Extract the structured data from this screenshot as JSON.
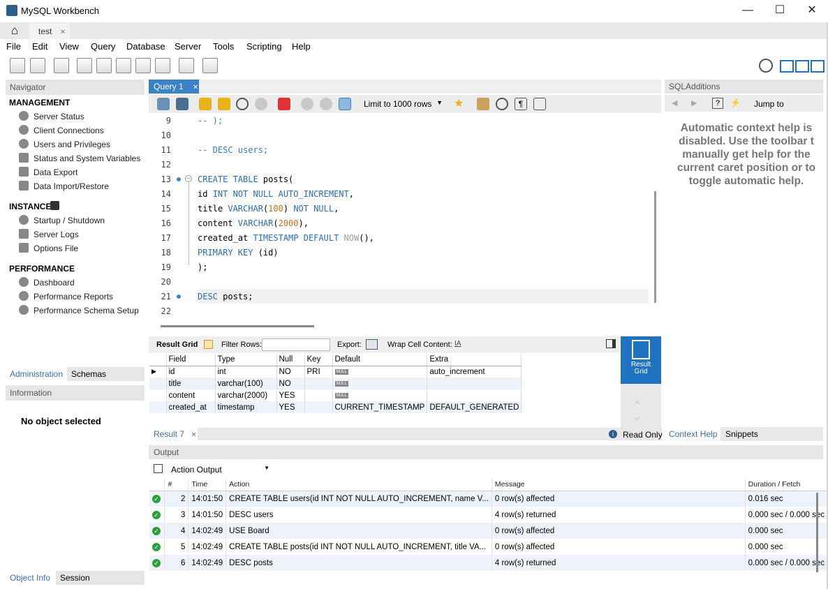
{
  "window": {
    "title": "MySQL Workbench",
    "minimize": "—",
    "maximize": "☐",
    "close": "✕"
  },
  "tabs": {
    "home_icon": "home-icon",
    "connection_tab": "test",
    "connection_close": "✕"
  },
  "menu": [
    "File",
    "Edit",
    "View",
    "Query",
    "Database",
    "Server",
    "Tools",
    "Scripting",
    "Help"
  ],
  "navigator": {
    "header": "Navigator",
    "management": {
      "title": "MANAGEMENT",
      "items": [
        "Server Status",
        "Client Connections",
        "Users and Privileges",
        "Status and System Variables",
        "Data Export",
        "Data Import/Restore"
      ]
    },
    "instance": {
      "title": "INSTANCE",
      "items": [
        "Startup / Shutdown",
        "Server Logs",
        "Options File"
      ]
    },
    "performance": {
      "title": "PERFORMANCE",
      "items": [
        "Dashboard",
        "Performance Reports",
        "Performance Schema Setup"
      ]
    },
    "tabs": [
      "Administration",
      "Schemas"
    ]
  },
  "information": {
    "header": "Information",
    "message": "No object selected",
    "tabs": [
      "Object Info",
      "Session"
    ]
  },
  "query_tab": {
    "label": "Query 1",
    "close": "✕",
    "limit": "Limit to 1000 rows"
  },
  "editor": {
    "lines": [
      "9",
      "10",
      "11",
      "12",
      "13",
      "14",
      "15",
      "16",
      "17",
      "18",
      "19",
      "20",
      "21",
      "22"
    ]
  },
  "result": {
    "result_grid_label": "Result Grid",
    "filter_label": "Filter Rows:",
    "export_label": "Export:",
    "wrap_label": "Wrap Cell Content:",
    "columns": [
      "Field",
      "Type",
      "Null",
      "Key",
      "Default",
      "Extra"
    ],
    "rows": [
      [
        "id",
        "int",
        "NO",
        "PRI",
        "NULL",
        "auto_increment"
      ],
      [
        "title",
        "varchar(100)",
        "NO",
        "",
        "NULL",
        ""
      ],
      [
        "content",
        "varchar(2000)",
        "YES",
        "",
        "NULL",
        ""
      ],
      [
        "created_at",
        "timestamp",
        "YES",
        "",
        "CURRENT_TIMESTAMP",
        "DEFAULT_GENERATED"
      ]
    ],
    "side_button": "Result Grid",
    "tab": "Result 7",
    "read_only": "Read Only"
  },
  "output": {
    "header": "Output",
    "selector": "Action Output",
    "columns": [
      "#",
      "Time",
      "Action",
      "Message",
      "Duration / Fetch"
    ],
    "rows": [
      [
        "2",
        "14:01:50",
        "CREATE TABLE users(id INT NOT NULL AUTO_INCREMENT, name V...",
        "0 row(s) affected",
        "0.016 sec"
      ],
      [
        "3",
        "14:01:50",
        "DESC users",
        "4 row(s) returned",
        "0.000 sec / 0.000 sec"
      ],
      [
        "4",
        "14:02:49",
        "USE Board",
        "0 row(s) affected",
        "0.000 sec"
      ],
      [
        "5",
        "14:02:49",
        "CREATE TABLE posts(id INT NOT NULL AUTO_INCREMENT, title VA...",
        "0 row(s) affected",
        "0.000 sec"
      ],
      [
        "6",
        "14:02:49",
        "DESC posts",
        "4 row(s) returned",
        "0.000 sec / 0.000 sec"
      ]
    ]
  },
  "sql_additions": {
    "header": "SQLAdditions",
    "jump_to": "Jump to",
    "help_text": "Automatic context help is disabled. Use the toolbar t manually get help for the current caret position or to toggle automatic help.",
    "tabs": [
      "Context Help",
      "Snippets"
    ]
  },
  "colors": {
    "accent": "#3a82c4",
    "keyword": "#2a6db5",
    "number": "#c8701e",
    "ok": "#2e9e3e"
  }
}
